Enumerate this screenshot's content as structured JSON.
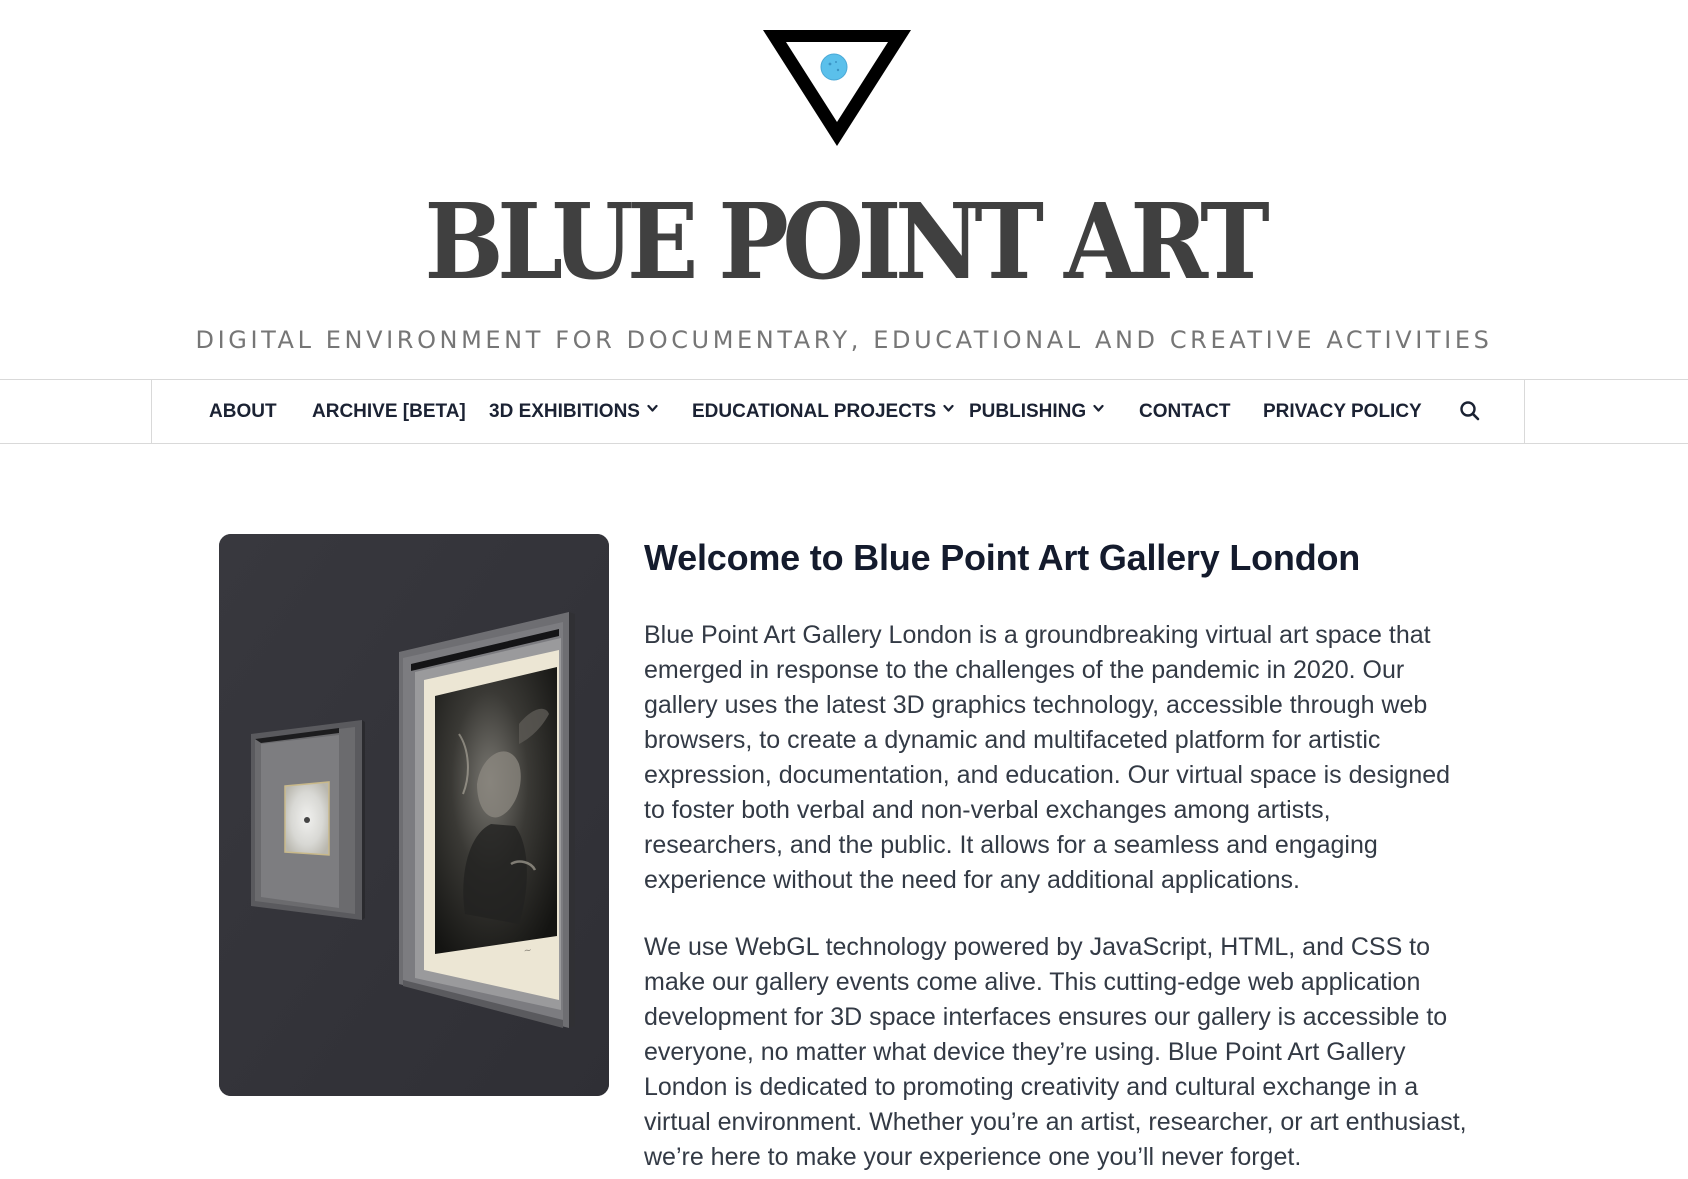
{
  "header": {
    "site_title": "BLUE POINT ART",
    "tagline": "DIGITAL ENVIRONMENT FOR DOCUMENTARY, EDUCATIONAL AND CREATIVE ACTIVITIES",
    "logo_icon": "inverted-triangle-blue-dot-logo",
    "logo_dot_color": "#5bc0eb"
  },
  "nav": {
    "items": [
      {
        "label": "ABOUT",
        "has_dropdown": false
      },
      {
        "label": "ARCHIVE [BETA]",
        "has_dropdown": false
      },
      {
        "label": "3D EXHIBITIONS",
        "has_dropdown": true
      },
      {
        "label": "EDUCATIONAL PROJECTS",
        "has_dropdown": true
      },
      {
        "label": "PUBLISHING",
        "has_dropdown": true
      },
      {
        "label": "CONTACT",
        "has_dropdown": false
      },
      {
        "label": "PRIVACY POLICY",
        "has_dropdown": false
      }
    ],
    "search_icon": "search-icon"
  },
  "main": {
    "hero_image_icon": "virtual-gallery-3d-frames-image",
    "title": "Welcome to Blue Point Art Gallery London",
    "paragraphs": [
      "Blue Point Art Gallery London is a groundbreaking virtual art space that emerged in response to the challenges of the pandemic in 2020. Our gallery uses the latest 3D graphics technology, accessible through web browsers, to create a dynamic and multifaceted platform for artistic expression, documentation, and education. Our virtual space is designed to foster both verbal and non-verbal exchanges among artists, researchers, and the public. It allows for a seamless and engaging experience without the need for any additional applications.",
      "We use WebGL technology powered by JavaScript, HTML, and CSS to make our gallery events come alive. This cutting-edge web application development for 3D space interfaces ensures our gallery is accessible to everyone, no matter what device they’re using. Blue Point Art Gallery London is dedicated to promoting creativity and cultural exchange in a virtual environment. Whether you’re an artist, researcher, or art enthusiast, we’re here to make your experience one you’ll never forget."
    ]
  },
  "colors": {
    "title_gray": "#404040",
    "tagline_gray": "#767676",
    "nav_text": "#1b2233",
    "body_text": "#333a45",
    "heading_text": "#141b2d",
    "hero_bg": "#34343a"
  }
}
